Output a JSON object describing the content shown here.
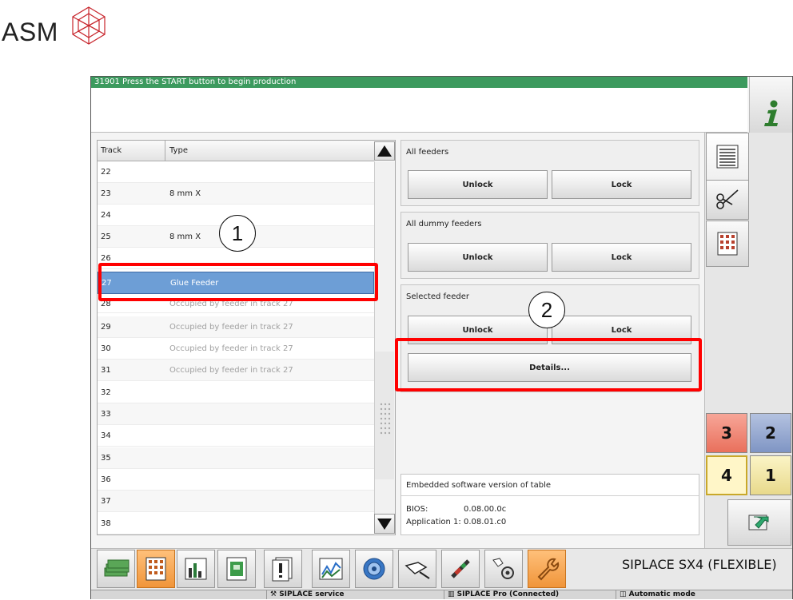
{
  "logo": {
    "text": "ASM"
  },
  "status_message": "31901 Press the START button to begin production",
  "table": {
    "headers": {
      "track": "Track",
      "type": "Type"
    },
    "rows": [
      {
        "track": "22",
        "type": ""
      },
      {
        "track": "23",
        "type": "8 mm X"
      },
      {
        "track": "24",
        "type": ""
      },
      {
        "track": "25",
        "type": "8 mm X"
      },
      {
        "track": "26",
        "type": ""
      },
      {
        "track": "27",
        "type": "Glue Feeder"
      },
      {
        "track": "28",
        "type": "Occupied by feeder in track 27"
      },
      {
        "track": "29",
        "type": "Occupied by feeder in track 27"
      },
      {
        "track": "30",
        "type": "Occupied by feeder in track 27"
      },
      {
        "track": "31",
        "type": "Occupied by feeder in track 27"
      },
      {
        "track": "32",
        "type": ""
      },
      {
        "track": "33",
        "type": ""
      },
      {
        "track": "34",
        "type": ""
      },
      {
        "track": "35",
        "type": ""
      },
      {
        "track": "36",
        "type": ""
      },
      {
        "track": "37",
        "type": ""
      },
      {
        "track": "38",
        "type": ""
      }
    ]
  },
  "groups": {
    "all_feeders": {
      "title": "All feeders",
      "unlock": "Unlock",
      "lock": "Lock"
    },
    "all_dummy": {
      "title": "All dummy feeders",
      "unlock": "Unlock",
      "lock": "Lock"
    },
    "selected": {
      "title": "Selected feeder",
      "unlock": "Unlock",
      "lock": "Lock",
      "details": "Details..."
    }
  },
  "version": {
    "title": "Embedded software version of table",
    "bios_label": "BIOS:",
    "bios_value": "0.08.00.0c",
    "app_label": "Application 1:",
    "app_value": "0.08.01.c0"
  },
  "number_buttons": {
    "n3": "3",
    "n2": "2",
    "n4": "4",
    "n1": "1"
  },
  "machine_name": "SIPLACE SX4 (FLEXIBLE)",
  "footer": {
    "service": "SIPLACE service",
    "pro": "SIPLACE Pro (Connected)",
    "mode": "Automatic mode"
  },
  "callouts": {
    "one": "1",
    "two": "2"
  },
  "colors": {
    "status_bar": "#3c9a5e",
    "selected_row": "#6d9ed6",
    "highlight": "#ff0000",
    "orange_button": "#f0953a",
    "btn3": "#f08a78",
    "btn2": "#8fa3cc"
  },
  "icons": [
    "asm-logo-icon",
    "info-icon",
    "list-icon",
    "scissors-icon",
    "grid-icon",
    "arrow-icon",
    "money-icon",
    "feeder-grid-icon",
    "bar-chart-icon",
    "board-icon",
    "warning-icon",
    "trend-chart-icon",
    "camera-icon",
    "nozzle-icon",
    "tool-icon",
    "gear-hand-icon",
    "wrench-icon"
  ]
}
